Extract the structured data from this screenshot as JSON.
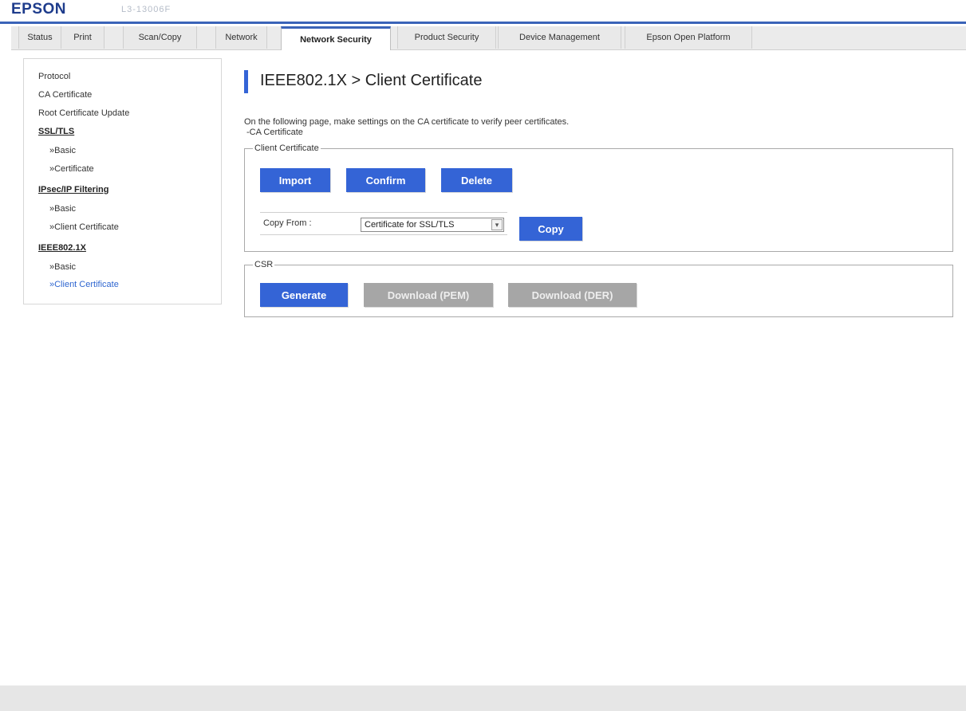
{
  "header": {
    "brand": "EPSON",
    "model": "L3-13006F"
  },
  "tabs": [
    {
      "label": "Status"
    },
    {
      "label": "Print"
    },
    {
      "label": "Scan/Copy"
    },
    {
      "label": "Network"
    },
    {
      "label": "Network Security",
      "active": true
    },
    {
      "label": "Product Security"
    },
    {
      "label": "Device Management"
    },
    {
      "label": "Epson Open Platform"
    }
  ],
  "sidebar": {
    "items": [
      {
        "label": "Protocol"
      },
      {
        "label": "CA Certificate"
      },
      {
        "label": "Root Certificate Update"
      },
      {
        "label": "SSL/TLS",
        "type": "heading"
      },
      {
        "label": "»Basic"
      },
      {
        "label": "»Certificate"
      },
      {
        "label": "IPsec/IP Filtering",
        "type": "heading"
      },
      {
        "label": "»Basic"
      },
      {
        "label": "»Client Certificate"
      },
      {
        "label": "IEEE802.1X",
        "type": "heading"
      },
      {
        "label": "»Basic"
      },
      {
        "label": "»Client Certificate",
        "current": true
      }
    ]
  },
  "main": {
    "title": "IEEE802.1X > Client Certificate",
    "description": "On the following page, make settings on the CA certificate to verify peer certificates.",
    "description_link": "-CA Certificate",
    "client_certificate": {
      "legend": "Client Certificate",
      "import_label": "Import",
      "confirm_label": "Confirm",
      "delete_label": "Delete",
      "copy_from_label": "Copy From :",
      "copy_from_value": "Certificate for SSL/TLS",
      "copy_label": "Copy"
    },
    "csr": {
      "legend": "CSR",
      "generate_label": "Generate",
      "download_pem_label": "Download (PEM)",
      "download_der_label": "Download (DER)"
    }
  },
  "colors": {
    "accent": "#3464d6",
    "disabled": "#a6a6a6",
    "brand": "#1e3c8c"
  }
}
